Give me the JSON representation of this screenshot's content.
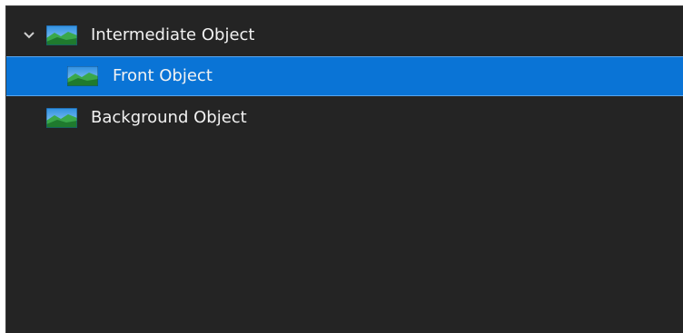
{
  "tree": {
    "items": [
      {
        "label": "Intermediate Object",
        "icon": "image-object-icon",
        "expanded": true,
        "selected": false
      },
      {
        "label": "Front Object",
        "icon": "image-object-icon",
        "selected": true
      },
      {
        "label": "Background Object",
        "icon": "image-object-icon",
        "selected": false
      }
    ]
  },
  "colors": {
    "panel_background": "#242424",
    "selection": "#0a74d6",
    "text": "#f2f2f2",
    "chevron": "#cfcfcf"
  }
}
